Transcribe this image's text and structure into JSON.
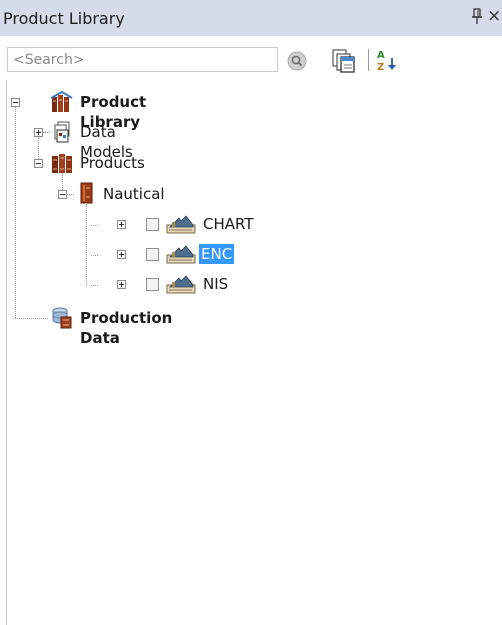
{
  "panel": {
    "title": "Product Library",
    "pin_icon": "pin-icon",
    "close_label": "×"
  },
  "toolbar": {
    "search_placeholder": "<Search>",
    "search_button_icon": "search-icon",
    "copy_button_icon": "copy-icon",
    "sort_button_icon": "sort-az-icon"
  },
  "tree": {
    "root": {
      "label": "Product Library",
      "expanded": true,
      "icon": "library-icon"
    },
    "data_models": {
      "label": "Data Models",
      "expanded": false,
      "icon": "data-models-icon"
    },
    "products": {
      "label": "Products",
      "expanded": true,
      "icon": "products-icon"
    },
    "nautical": {
      "label": "Nautical",
      "expanded": true,
      "icon": "book-icon"
    },
    "chart": {
      "label": "CHART",
      "expanded": false,
      "checked": false,
      "icon": "product-class-icon"
    },
    "enc": {
      "label": "ENC",
      "expanded": false,
      "checked": false,
      "selected": true,
      "icon": "product-class-icon"
    },
    "nis": {
      "label": "NIS",
      "expanded": false,
      "checked": false,
      "icon": "product-class-icon"
    },
    "production_data": {
      "label": "Production Data",
      "icon": "production-data-icon"
    }
  },
  "colors": {
    "titlebar_bg": "#d6dbe9",
    "selection": "#3399ff"
  }
}
